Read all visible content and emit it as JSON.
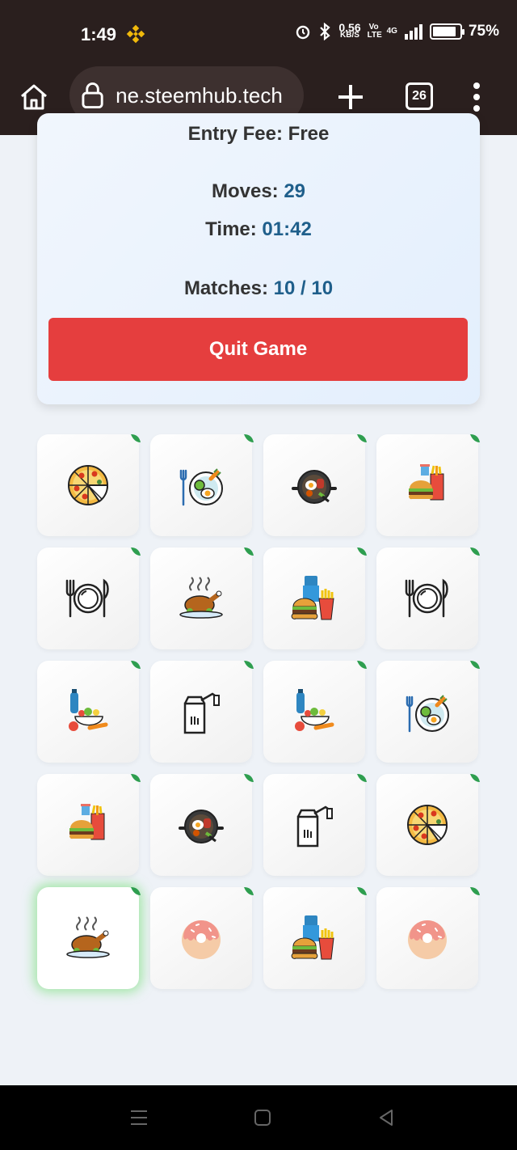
{
  "status_bar": {
    "time": "1:49",
    "net_speed": "0.56",
    "net_unit": "KB/S",
    "volte": "Vo LTE",
    "network": "4G",
    "battery": "75%"
  },
  "browser": {
    "url": "ne.steemhub.tech",
    "tab_count": "26"
  },
  "game": {
    "entry_fee_label": "Entry Fee:",
    "entry_fee_value": "Free",
    "moves_label": "Moves:",
    "moves_value": "29",
    "time_label": "Time:",
    "time_value": "01:42",
    "matches_label": "Matches:",
    "matches_value": "10 / 10",
    "quit_label": "Quit Game"
  },
  "cards": [
    {
      "icon": "pizza-icon"
    },
    {
      "icon": "breakfast-plate-icon"
    },
    {
      "icon": "pan-food-icon"
    },
    {
      "icon": "fast-food-combo-icon"
    },
    {
      "icon": "plate-cutlery-icon"
    },
    {
      "icon": "roast-chicken-icon"
    },
    {
      "icon": "burger-fries-icon"
    },
    {
      "icon": "plate-cutlery-icon"
    },
    {
      "icon": "healthy-food-icon"
    },
    {
      "icon": "takeaway-bag-icon"
    },
    {
      "icon": "healthy-food-icon"
    },
    {
      "icon": "breakfast-plate-icon"
    },
    {
      "icon": "fast-food-combo-icon"
    },
    {
      "icon": "pan-food-icon"
    },
    {
      "icon": "takeaway-bag-icon"
    },
    {
      "icon": "pizza-icon"
    },
    {
      "icon": "roast-chicken-icon"
    },
    {
      "icon": "donut-icon"
    },
    {
      "icon": "burger-fries-icon"
    },
    {
      "icon": "donut-icon"
    }
  ],
  "colors": {
    "accent": "#1f5f8b",
    "quit": "#e53e3e",
    "matched_corner": "#2e9e4f",
    "topbar": "#2a1f1e"
  }
}
